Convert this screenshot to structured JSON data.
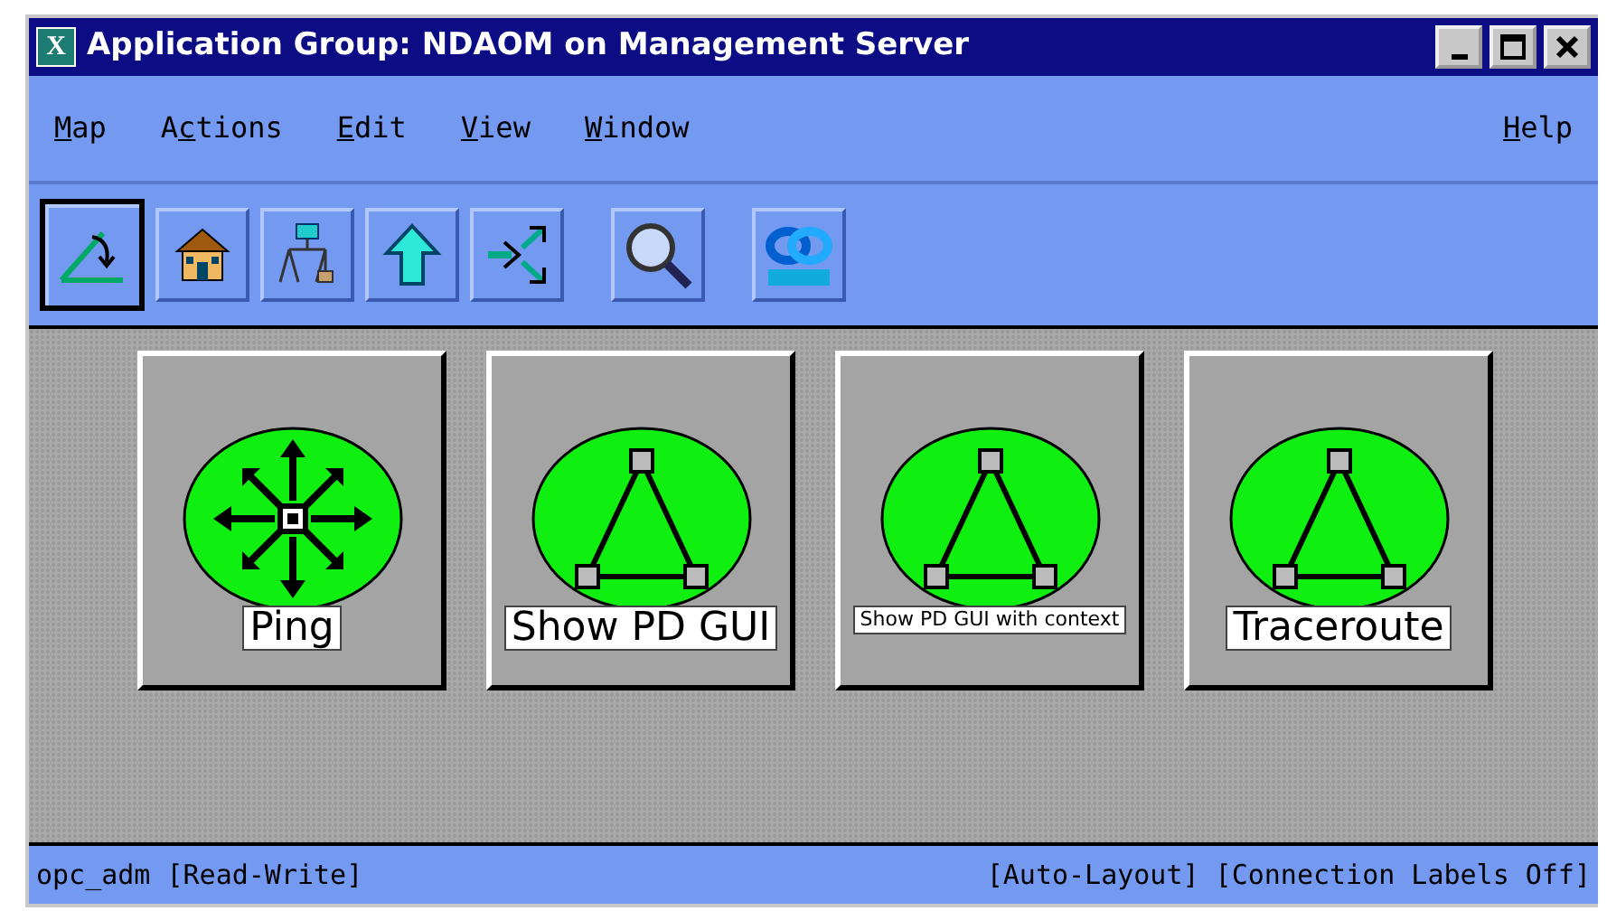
{
  "window": {
    "title": "Application Group: NDAOM on Management Server",
    "icon": "X"
  },
  "menu": [
    {
      "key": "M",
      "after": "ap"
    },
    {
      "before": "A",
      "key": "c",
      "after": "tions"
    },
    {
      "key": "E",
      "after": "dit"
    },
    {
      "key": "V",
      "after": "iew"
    },
    {
      "key": "W",
      "after": "indow"
    },
    {
      "key": "H",
      "after": "elp"
    }
  ],
  "toolbar": [
    {
      "kind": "edit",
      "selected": true
    },
    {
      "kind": "home",
      "selected": false
    },
    {
      "kind": "tree",
      "selected": false
    },
    {
      "kind": "up",
      "selected": false
    },
    {
      "kind": "split",
      "selected": false
    },
    {
      "kind": "gap"
    },
    {
      "kind": "search",
      "selected": false
    },
    {
      "kind": "gap"
    },
    {
      "kind": "logo",
      "selected": false
    }
  ],
  "applications": [
    {
      "label": "Ping",
      "kind": "ping"
    },
    {
      "label": "Show PD GUI",
      "kind": "triangle"
    },
    {
      "label": "Show PD GUI with context",
      "kind": "triangle"
    },
    {
      "label": "Traceroute",
      "kind": "triangle"
    }
  ],
  "status_bar": {
    "left": "opc_adm [Read-Write]",
    "right": "[Auto-Layout] [Connection Labels Off]"
  }
}
